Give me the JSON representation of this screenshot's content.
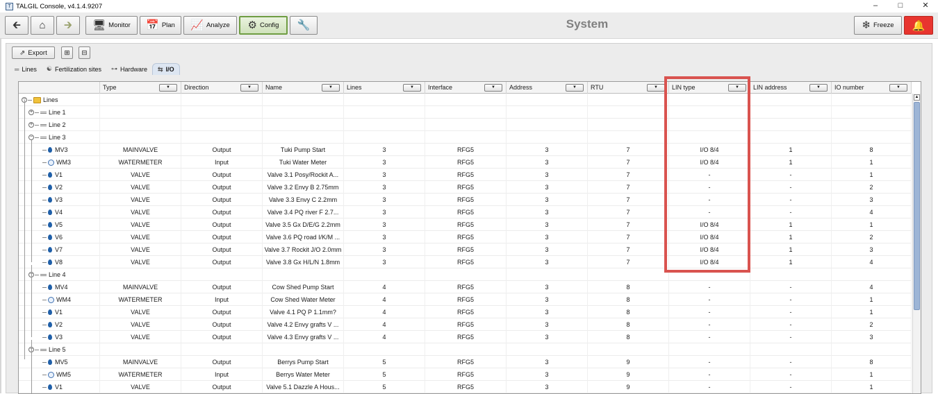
{
  "window": {
    "title": "TALGIL Console, v4.1.4.9207",
    "app_icon": "T",
    "controls": [
      "minimize-icon",
      "maximize-icon",
      "close-icon"
    ]
  },
  "toolbar": {
    "back": "arrow-left-icon",
    "home": "home-icon",
    "forward": "arrow-right-icon",
    "monitor_label": "Monitor",
    "plan_label": "Plan",
    "analyze_label": "Analyze",
    "config_label": "Config",
    "tools": "tools-icon",
    "page_title": "System",
    "freeze_label": "Freeze",
    "alarm": "bell-icon",
    "alarm_color": "#e8352f",
    "active_color": "#6f9d42"
  },
  "subbar": {
    "export_label": "Export",
    "expand": "⊞",
    "collapse": "⊟"
  },
  "tabs": [
    {
      "label": "Lines",
      "icon": "lines-icon"
    },
    {
      "label": "Fertilization sites",
      "icon": "fertilizer-icon"
    },
    {
      "label": "Hardware",
      "icon": "hardware-icon"
    },
    {
      "label": "I/O",
      "icon": "io-icon",
      "selected": true
    }
  ],
  "columns": [
    "",
    "Type",
    "Direction",
    "Name",
    "Lines",
    "Interface",
    "Address",
    "RTU",
    "LIN type",
    "LIN address",
    "IO number"
  ],
  "highlight_color": "#d9534f",
  "tree_root": "Lines",
  "rows": [
    {
      "kind": "line",
      "label": "Line 1"
    },
    {
      "kind": "line",
      "label": "Line 2"
    },
    {
      "kind": "line",
      "label": "Line 3"
    },
    {
      "kind": "dev",
      "icon": "drop",
      "label": "MV3",
      "type": "MAINVALVE",
      "dir": "Output",
      "name": "Tuki Pump Start",
      "lines": "3",
      "iface": "RFG5",
      "addr": "3",
      "rtu": "7",
      "lin_type": "I/O 8/4",
      "lin_addr": "1",
      "io": "8"
    },
    {
      "kind": "dev",
      "icon": "meter",
      "label": "WM3",
      "type": "WATERMETER",
      "dir": "Input",
      "name": "Tuki Water Meter",
      "lines": "3",
      "iface": "RFG5",
      "addr": "3",
      "rtu": "7",
      "lin_type": "I/O 8/4",
      "lin_addr": "1",
      "io": "1"
    },
    {
      "kind": "dev",
      "icon": "drop",
      "label": "V1",
      "type": "VALVE",
      "dir": "Output",
      "name": "Valve 3.1 Posy/Rockit  A...",
      "lines": "3",
      "iface": "RFG5",
      "addr": "3",
      "rtu": "7",
      "lin_type": "-",
      "lin_addr": "-",
      "io": "1"
    },
    {
      "kind": "dev",
      "icon": "drop",
      "label": "V2",
      "type": "VALVE",
      "dir": "Output",
      "name": "Valve 3.2 Envy B 2.75mm",
      "lines": "3",
      "iface": "RFG5",
      "addr": "3",
      "rtu": "7",
      "lin_type": "-",
      "lin_addr": "-",
      "io": "2"
    },
    {
      "kind": "dev",
      "icon": "drop",
      "label": "V3",
      "type": "VALVE",
      "dir": "Output",
      "name": "Valve 3.3 Envy C 2.2mm",
      "lines": "3",
      "iface": "RFG5",
      "addr": "3",
      "rtu": "7",
      "lin_type": "-",
      "lin_addr": "-",
      "io": "3"
    },
    {
      "kind": "dev",
      "icon": "drop",
      "label": "V4",
      "type": "VALVE",
      "dir": "Output",
      "name": "Valve 3.4 PQ river F 2.7...",
      "lines": "3",
      "iface": "RFG5",
      "addr": "3",
      "rtu": "7",
      "lin_type": "-",
      "lin_addr": "-",
      "io": "4"
    },
    {
      "kind": "dev",
      "icon": "drop",
      "label": "V5",
      "type": "VALVE",
      "dir": "Output",
      "name": "Valve 3.5 Gx D/E/G 2.2mm",
      "lines": "3",
      "iface": "RFG5",
      "addr": "3",
      "rtu": "7",
      "lin_type": "I/O 8/4",
      "lin_addr": "1",
      "io": "1"
    },
    {
      "kind": "dev",
      "icon": "drop",
      "label": "V6",
      "type": "VALVE",
      "dir": "Output",
      "name": "Valve 3.6 PQ road I/K/M ...",
      "lines": "3",
      "iface": "RFG5",
      "addr": "3",
      "rtu": "7",
      "lin_type": "I/O 8/4",
      "lin_addr": "1",
      "io": "2"
    },
    {
      "kind": "dev",
      "icon": "drop",
      "label": "V7",
      "type": "VALVE",
      "dir": "Output",
      "name": "Valve 3.7 Rockit J/O 2.0mm",
      "lines": "3",
      "iface": "RFG5",
      "addr": "3",
      "rtu": "7",
      "lin_type": "I/O 8/4",
      "lin_addr": "1",
      "io": "3"
    },
    {
      "kind": "dev",
      "icon": "drop",
      "label": "V8",
      "type": "VALVE",
      "dir": "Output",
      "name": "Valve 3.8 Gx H/L/N 1.8mm",
      "lines": "3",
      "iface": "RFG5",
      "addr": "3",
      "rtu": "7",
      "lin_type": "I/O 8/4",
      "lin_addr": "1",
      "io": "4"
    },
    {
      "kind": "line",
      "label": "Line 4"
    },
    {
      "kind": "dev",
      "icon": "drop",
      "label": "MV4",
      "type": "MAINVALVE",
      "dir": "Output",
      "name": "Cow Shed Pump Start",
      "lines": "4",
      "iface": "RFG5",
      "addr": "3",
      "rtu": "8",
      "lin_type": "-",
      "lin_addr": "-",
      "io": "4"
    },
    {
      "kind": "dev",
      "icon": "meter",
      "label": "WM4",
      "type": "WATERMETER",
      "dir": "Input",
      "name": "Cow Shed Water Meter",
      "lines": "4",
      "iface": "RFG5",
      "addr": "3",
      "rtu": "8",
      "lin_type": "-",
      "lin_addr": "-",
      "io": "1"
    },
    {
      "kind": "dev",
      "icon": "drop",
      "label": "V1",
      "type": "VALVE",
      "dir": "Output",
      "name": "Valve 4.1 PQ P 1.1mm?",
      "lines": "4",
      "iface": "RFG5",
      "addr": "3",
      "rtu": "8",
      "lin_type": "-",
      "lin_addr": "-",
      "io": "1"
    },
    {
      "kind": "dev",
      "icon": "drop",
      "label": "V2",
      "type": "VALVE",
      "dir": "Output",
      "name": "Valve 4.2 Envy grafts V ...",
      "lines": "4",
      "iface": "RFG5",
      "addr": "3",
      "rtu": "8",
      "lin_type": "-",
      "lin_addr": "-",
      "io": "2"
    },
    {
      "kind": "dev",
      "icon": "drop",
      "label": "V3",
      "type": "VALVE",
      "dir": "Output",
      "name": "Valve 4.3 Envy grafts V ...",
      "lines": "4",
      "iface": "RFG5",
      "addr": "3",
      "rtu": "8",
      "lin_type": "-",
      "lin_addr": "-",
      "io": "3"
    },
    {
      "kind": "line",
      "label": "Line 5"
    },
    {
      "kind": "dev",
      "icon": "drop",
      "label": "MV5",
      "type": "MAINVALVE",
      "dir": "Output",
      "name": "Berrys Pump Start",
      "lines": "5",
      "iface": "RFG5",
      "addr": "3",
      "rtu": "9",
      "lin_type": "-",
      "lin_addr": "-",
      "io": "8"
    },
    {
      "kind": "dev",
      "icon": "meter",
      "label": "WM5",
      "type": "WATERMETER",
      "dir": "Input",
      "name": "Berrys Water Meter",
      "lines": "5",
      "iface": "RFG5",
      "addr": "3",
      "rtu": "9",
      "lin_type": "-",
      "lin_addr": "-",
      "io": "1"
    },
    {
      "kind": "dev",
      "icon": "drop",
      "label": "V1",
      "type": "VALVE",
      "dir": "Output",
      "name": "Valve 5.1 Dazzle A Hous...",
      "lines": "5",
      "iface": "RFG5",
      "addr": "3",
      "rtu": "9",
      "lin_type": "-",
      "lin_addr": "-",
      "io": "1"
    }
  ]
}
